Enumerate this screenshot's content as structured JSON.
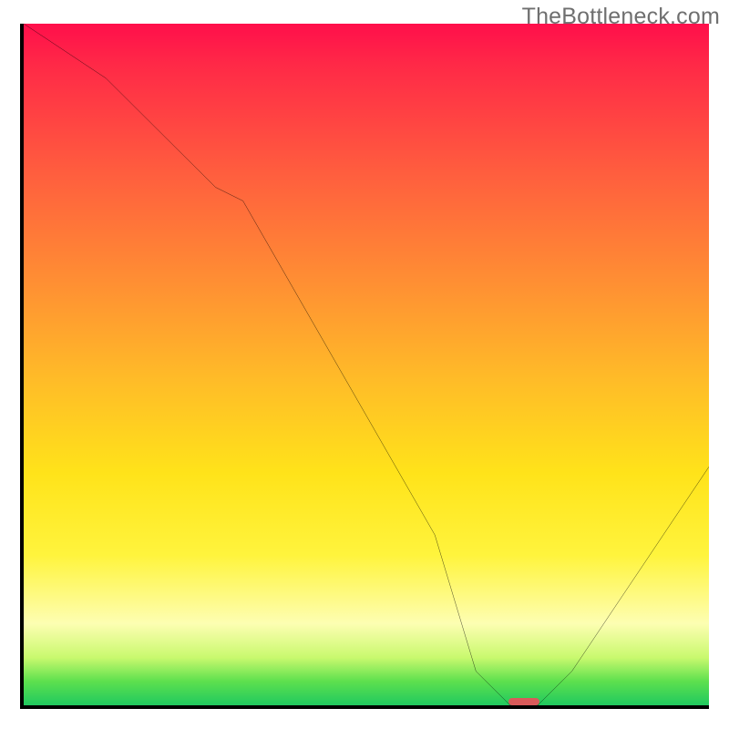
{
  "watermark": "TheBottleneck.com",
  "chart_data": {
    "type": "line",
    "title": "",
    "xlabel": "",
    "ylabel": "",
    "xlim": [
      0,
      100
    ],
    "ylim": [
      0,
      100
    ],
    "x": [
      0,
      12,
      28,
      32,
      60,
      66,
      71,
      75,
      80,
      100
    ],
    "values": [
      100,
      92,
      76,
      74,
      25,
      5,
      0,
      0,
      5,
      35
    ],
    "marker": {
      "x": 73,
      "y": 0,
      "width_pct": 4.6,
      "height_pct": 1.1
    },
    "gradient_stops": [
      {
        "pct": 0,
        "color": "#ff0f4b"
      },
      {
        "pct": 22,
        "color": "#ff5e3e"
      },
      {
        "pct": 52,
        "color": "#ffbb28"
      },
      {
        "pct": 78,
        "color": "#fff43d"
      },
      {
        "pct": 93,
        "color": "#c9f96e"
      },
      {
        "pct": 100,
        "color": "#20c95f"
      }
    ]
  }
}
